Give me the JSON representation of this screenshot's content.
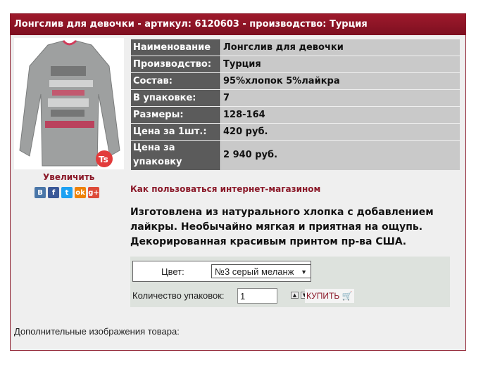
{
  "header": {
    "title": "Лонгслив для девочки - артикул: 6120603 - производство: Турция"
  },
  "product": {
    "enlarge_label": "Увеличить",
    "social": [
      {
        "icon": "vk-icon",
        "glyph": "B",
        "color": "#4a76a8"
      },
      {
        "icon": "facebook-icon",
        "glyph": "f",
        "color": "#3b5998"
      },
      {
        "icon": "twitter-icon",
        "glyph": "t",
        "color": "#1da1f2"
      },
      {
        "icon": "odnoklassniki-icon",
        "glyph": "ok",
        "color": "#ee8208"
      },
      {
        "icon": "googleplus-icon",
        "glyph": "g+",
        "color": "#dd4b39"
      }
    ],
    "specs": [
      {
        "key": "Наименование",
        "value": "Лонгслив для девочки"
      },
      {
        "key": "Производство:",
        "value": "Турция"
      },
      {
        "key": "Состав:",
        "value": "95%хлопок 5%лайкра"
      },
      {
        "key": "В упаковке:",
        "value": "7"
      },
      {
        "key": "Размеры:",
        "value": "128-164"
      },
      {
        "key": "Цена за 1шт.:",
        "value": "420 руб."
      },
      {
        "key": "Цена за упаковку",
        "value": "2 940 руб."
      }
    ],
    "howto_link": "Как пользоваться интернет-магазином",
    "description": "Изготовлена из натурального хлопка с добавлением лайкры. Необычайно мягкая и приятная на ощупь. Декорированная красивым принтом пр-ва США.",
    "color_label": "Цвет:",
    "color_selected": "№3 серый меланж",
    "qty_label": "Количество упаковок:",
    "qty_value": "1",
    "buy_label": "КУПИТЬ",
    "extra_images_label": "Дополнительные изображения товара:"
  }
}
